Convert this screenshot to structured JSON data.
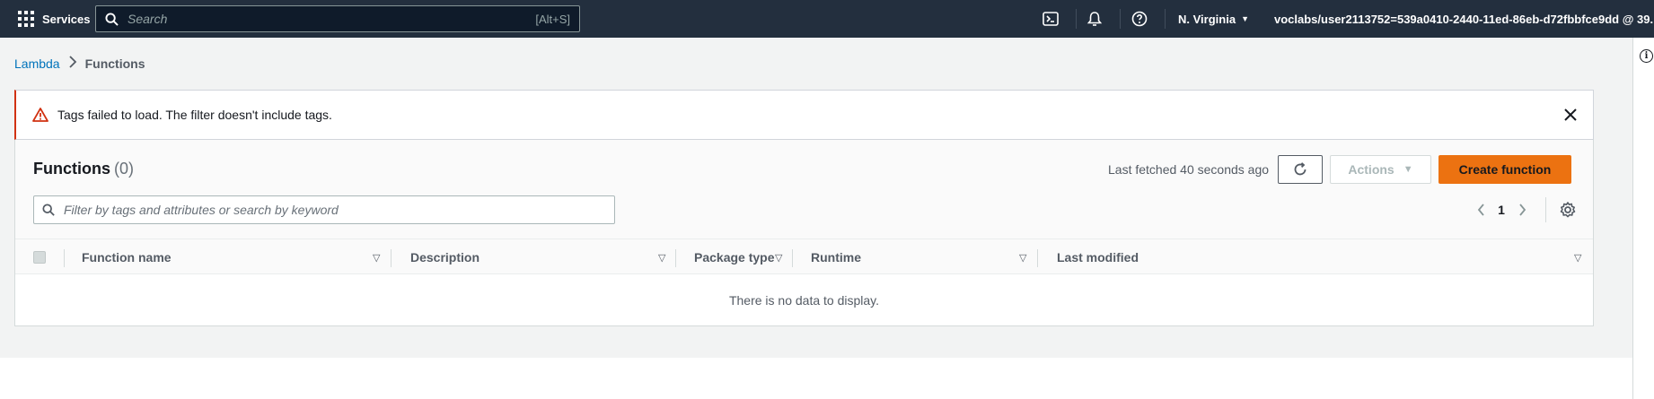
{
  "topnav": {
    "services_label": "Services",
    "search_placeholder": "Search",
    "search_shortcut": "[Alt+S]",
    "region": "N. Virginia",
    "account": "voclabs/user2113752=539a0410-2440-11ed-86eb-d72fbbfce9dd @ 39...",
    "colors": {
      "background": "#232f3e"
    }
  },
  "breadcrumb": {
    "items": [
      "Lambda",
      "Functions"
    ]
  },
  "alert": {
    "message": "Tags failed to load. The filter doesn't include tags.",
    "icon": "warning-icon",
    "color": "#d13212"
  },
  "panel": {
    "title": "Functions",
    "count": "(0)",
    "last_fetched": "Last fetched 40 seconds ago",
    "actions_label": "Actions",
    "create_label": "Create function",
    "filter_placeholder": "Filter by tags and attributes or search by keyword",
    "page_number": "1",
    "colors": {
      "primary": "#ec7211"
    }
  },
  "table": {
    "columns": [
      "Function name",
      "Description",
      "Package type",
      "Runtime",
      "Last modified"
    ],
    "empty_message": "There is no data to display."
  }
}
